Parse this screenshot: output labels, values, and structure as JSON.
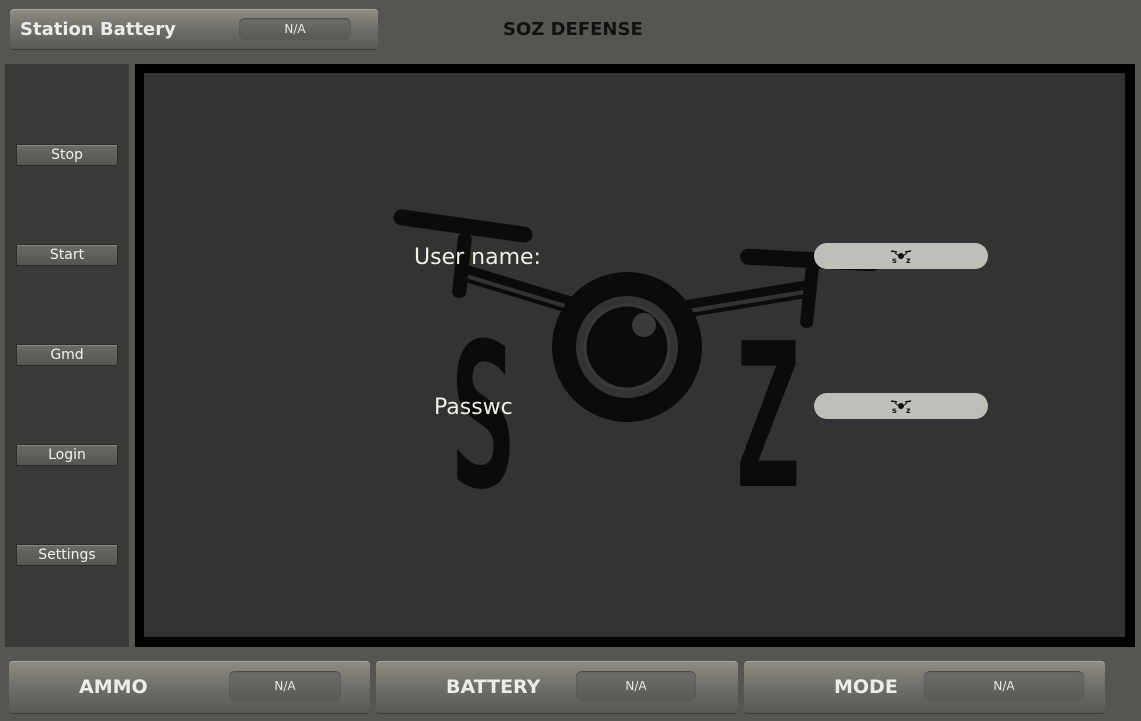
{
  "header": {
    "station_battery_label": "Station Battery",
    "station_battery_value": "N/A",
    "title": "SOZ DEFENSE"
  },
  "sidebar": {
    "items": [
      {
        "label": "Stop"
      },
      {
        "label": "Start"
      },
      {
        "label": "Gmd"
      },
      {
        "label": "Login"
      },
      {
        "label": "Settings"
      }
    ]
  },
  "login": {
    "username_label": "User name:",
    "password_label": "Passwc",
    "username_icon": "soz-drone-logo-icon",
    "password_icon": "soz-drone-logo-icon",
    "logo_text_left": "S",
    "logo_text_right": "Z"
  },
  "status_bar": {
    "ammo_label": "AMMO",
    "ammo_value": "N/A",
    "battery_label": "BATTERY",
    "battery_value": "N/A",
    "mode_label": "MODE",
    "mode_value": "N/A"
  },
  "colors": {
    "background": "#555551",
    "panel": "#333333",
    "field": "#bfbfb9",
    "label_text": "#f2efe6"
  }
}
